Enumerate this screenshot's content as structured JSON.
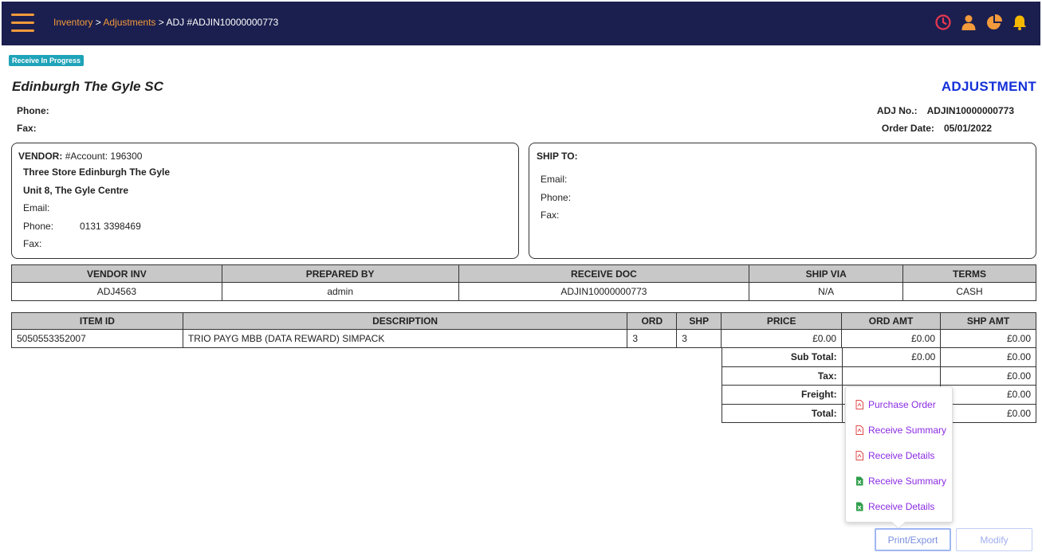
{
  "header": {
    "breadcrumb": [
      "Inventory",
      "Adjustments"
    ],
    "breadcrumb_current": "ADJ #ADJIN10000000773",
    "icons": [
      "clock-icon",
      "user-icon",
      "pie-chart-icon",
      "bell-icon"
    ],
    "accent_color": "#f39a3b",
    "bar_color": "#1b1f4f"
  },
  "status": "Receive In Progress",
  "store": {
    "name": "Edinburgh The Gyle SC",
    "phone_label": "Phone:",
    "fax_label": "Fax:"
  },
  "doc": {
    "type": "ADJUSTMENT",
    "adj_no_label": "ADJ No.:",
    "adj_no": "ADJIN10000000773",
    "order_date_label": "Order Date:",
    "order_date": "05/01/2022"
  },
  "vendor": {
    "title_label": "VENDOR:",
    "account": "#Account: 196300",
    "name": "Three Store Edinburgh The Gyle",
    "address": "Unit 8, The Gyle Centre",
    "email_label": "Email:",
    "phone_label": "Phone:",
    "phone": "0131 3398469",
    "fax_label": "Fax:"
  },
  "ship_to": {
    "title": "SHIP TO:",
    "email_label": "Email:",
    "phone_label": "Phone:",
    "fax_label": "Fax:"
  },
  "info_table": {
    "headers": [
      "VENDOR INV",
      "PREPARED BY",
      "RECEIVE DOC",
      "SHIP VIA",
      "TERMS"
    ],
    "values": [
      "ADJ4563",
      "admin",
      "ADJIN10000000773",
      "N/A",
      "CASH"
    ]
  },
  "items_table": {
    "headers": [
      "ITEM ID",
      "DESCRIPTION",
      "ORD",
      "SHP",
      "PRICE",
      "ORD AMT",
      "SHP AMT"
    ],
    "rows": [
      [
        "5050553352007",
        "TRIO PAYG MBB (DATA REWARD) SIMPACK",
        "3",
        "3",
        "£0.00",
        "£0.00",
        "£0.00"
      ]
    ]
  },
  "totals": {
    "subtotal_label": "Sub Total:",
    "subtotal_ord": "£0.00",
    "subtotal_shp": "£0.00",
    "tax_label": "Tax:",
    "tax_shp": "£0.00",
    "freight_label": "Freight:",
    "freight_shp": "£0.00",
    "total_label": "Total:",
    "total_shp": "£0.00"
  },
  "export_menu": {
    "items": [
      {
        "label": "Purchase Order",
        "icon": "pdf-icon"
      },
      {
        "label": "Receive Summary",
        "icon": "pdf-icon"
      },
      {
        "label": "Receive Details",
        "icon": "pdf-icon"
      },
      {
        "label": "Receive Summary",
        "icon": "excel-icon"
      },
      {
        "label": "Receive Details",
        "icon": "excel-icon"
      }
    ]
  },
  "buttons": {
    "print_export": "Print/Export",
    "modify": "Modify"
  }
}
